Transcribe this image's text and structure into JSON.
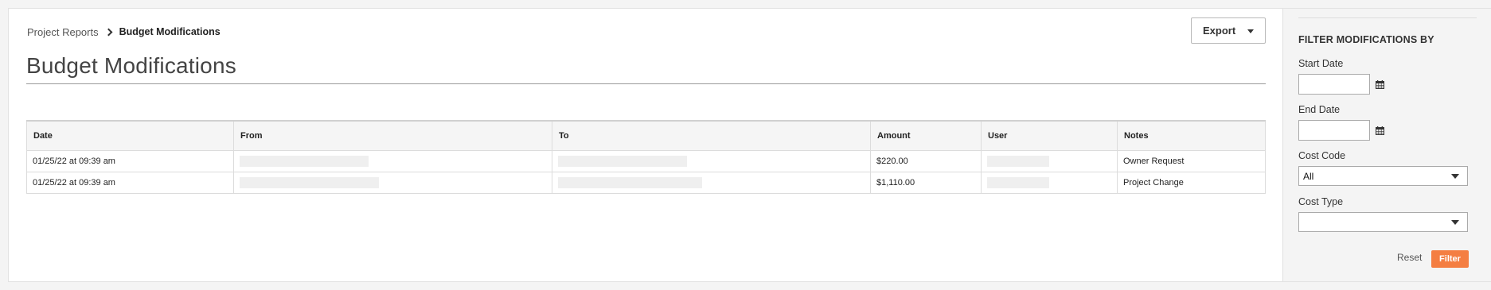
{
  "breadcrumb": {
    "parent": "Project Reports",
    "current": "Budget Modifications"
  },
  "page": {
    "title": "Budget Modifications"
  },
  "actions": {
    "export_label": "Export"
  },
  "table": {
    "headers": [
      "Date",
      "From",
      "To",
      "Amount",
      "User",
      "Notes"
    ],
    "rows": [
      {
        "date": "01/25/22 at 09:39 am",
        "amount": "$220.00",
        "notes": "Owner Request"
      },
      {
        "date": "01/25/22 at 09:39 am",
        "amount": "$1,110.00",
        "notes": "Project Change"
      }
    ]
  },
  "filters": {
    "heading": "FILTER MODIFICATIONS BY",
    "start_date_label": "Start Date",
    "start_date_value": "",
    "end_date_label": "End Date",
    "end_date_value": "",
    "cost_code_label": "Cost Code",
    "cost_code_value": "All",
    "cost_type_label": "Cost Type",
    "cost_type_value": "",
    "reset_label": "Reset",
    "filter_label": "Filter"
  },
  "colors": {
    "accent": "#f47e42",
    "sidebar_bg": "#f4f4f4"
  }
}
